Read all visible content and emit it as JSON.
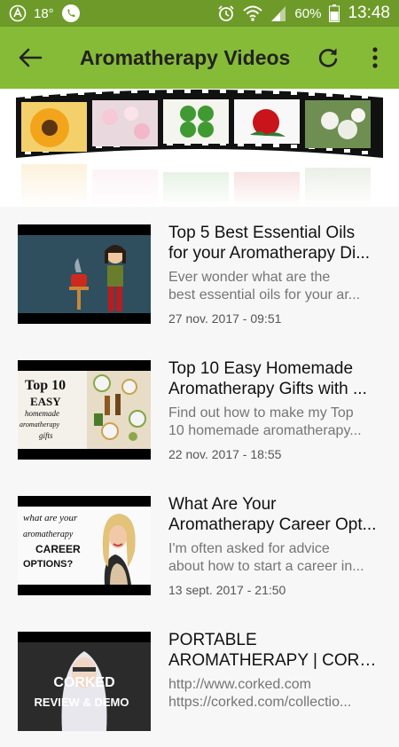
{
  "status_bar": {
    "temperature": "18°",
    "battery": "60%",
    "time": "13:48",
    "icons": [
      "avast-icon",
      "phone-icon",
      "alarm-icon",
      "wifi-icon",
      "signal-icon",
      "battery-icon"
    ]
  },
  "app_bar": {
    "title": "Aromatherapy Videos",
    "back_icon": "arrow-left-icon",
    "refresh_icon": "refresh-icon",
    "menu_icon": "more-vert-icon"
  },
  "banner": {
    "image": "film-strip-flowers",
    "flowers": [
      "sunflower",
      "cherry-blossom",
      "four-leaf-clover",
      "red-rose",
      "white-flowers"
    ]
  },
  "videos": [
    {
      "title_line1": "Top 5 Best Essential Oils",
      "title_line2": "for your Aromatherapy Di...",
      "desc_line1": "Ever wonder what are the",
      "desc_line2": "best essential oils for your ar...",
      "date": "27 nov. 2017 - 09:51",
      "thumb_text": ""
    },
    {
      "title_line1": "Top 10 Easy Homemade",
      "title_line2": "Aromatherapy Gifts with ...",
      "desc_line1": "Find out how to make my Top",
      "desc_line2": "10 homemade aromatherapy...",
      "date": "22 nov. 2017 - 18:55",
      "thumb_text": [
        "Top 10",
        "EASY",
        "homemade",
        "aromatherapy",
        "gifts"
      ]
    },
    {
      "title_line1": "What Are Your",
      "title_line2": "Aromatherapy Career Opt...",
      "desc_line1": "I'm often asked for advice",
      "desc_line2": "about how to start a career in...",
      "date": "13 sept. 2017 - 21:50",
      "thumb_text": [
        "what are your",
        "aromatherapy",
        "CAREER",
        "OPTIONS?"
      ]
    },
    {
      "title_line1": "PORTABLE",
      "title_line2": "AROMATHERAPY | CORK...",
      "desc_line1": "http://www.corked.com",
      "desc_line2": "https://corked.com/collectio...",
      "date": "",
      "thumb_text": [
        "CORKED",
        "REVIEW & DEMO"
      ]
    }
  ],
  "colors": {
    "status_bar": "#6e9a2a",
    "app_bar": "#86bb37",
    "background": "#f7f7f7"
  }
}
